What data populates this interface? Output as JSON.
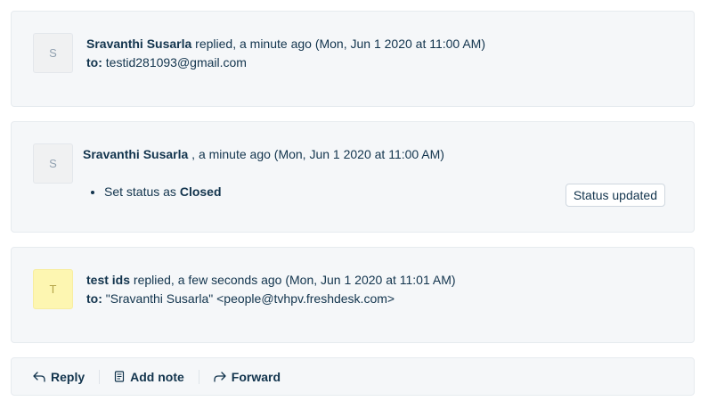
{
  "conversations": [
    {
      "avatar_letter": "S",
      "author": "Sravanthi Susarla",
      "meta": "replied, a minute ago (Mon, Jun 1 2020 at 11:00 AM)",
      "to_label": "to:",
      "to_value": "testid281093@gmail.com"
    },
    {
      "avatar_letter": "S",
      "author": "Sravanthi Susarla",
      "meta": ", a minute ago (Mon, Jun 1 2020 at 11:00 AM)",
      "activity_prefix": "Set status as ",
      "activity_value": "Closed",
      "badge": "Status updated"
    },
    {
      "avatar_letter": "T",
      "author": "test ids",
      "meta": "replied, a few seconds ago (Mon, Jun 1 2020 at 11:01 AM)",
      "to_label": "to:",
      "to_value": "\"Sravanthi Susarla\" <people@tvhpv.freshdesk.com>"
    }
  ],
  "actions": {
    "reply": "Reply",
    "add_note": "Add note",
    "forward": "Forward"
  },
  "icons": {
    "reply": "reply-arrow-icon",
    "add_note": "note-icon",
    "forward": "forward-arrow-icon"
  }
}
